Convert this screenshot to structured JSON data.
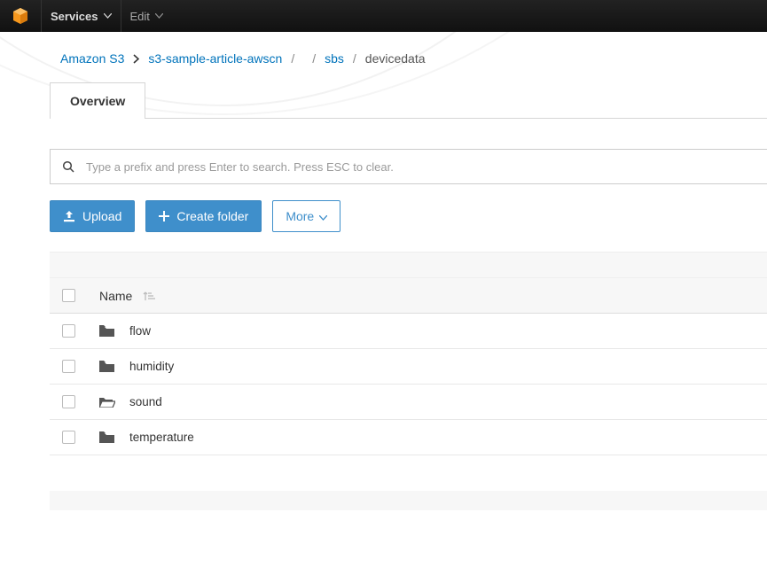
{
  "nav": {
    "services": "Services",
    "edit": "Edit"
  },
  "breadcrumb": {
    "root": "Amazon S3",
    "bucket": "s3-sample-article-awscn",
    "path1": "",
    "path2": "sbs",
    "current": "devicedata"
  },
  "tabs": {
    "overview": "Overview"
  },
  "search": {
    "placeholder": "Type a prefix and press Enter to search. Press ESC to clear."
  },
  "actions": {
    "upload": "Upload",
    "create_folder": "Create folder",
    "more": "More"
  },
  "table": {
    "header_name": "Name",
    "rows": [
      {
        "name": "flow"
      },
      {
        "name": "humidity"
      },
      {
        "name": "sound"
      },
      {
        "name": "temperature"
      }
    ]
  }
}
